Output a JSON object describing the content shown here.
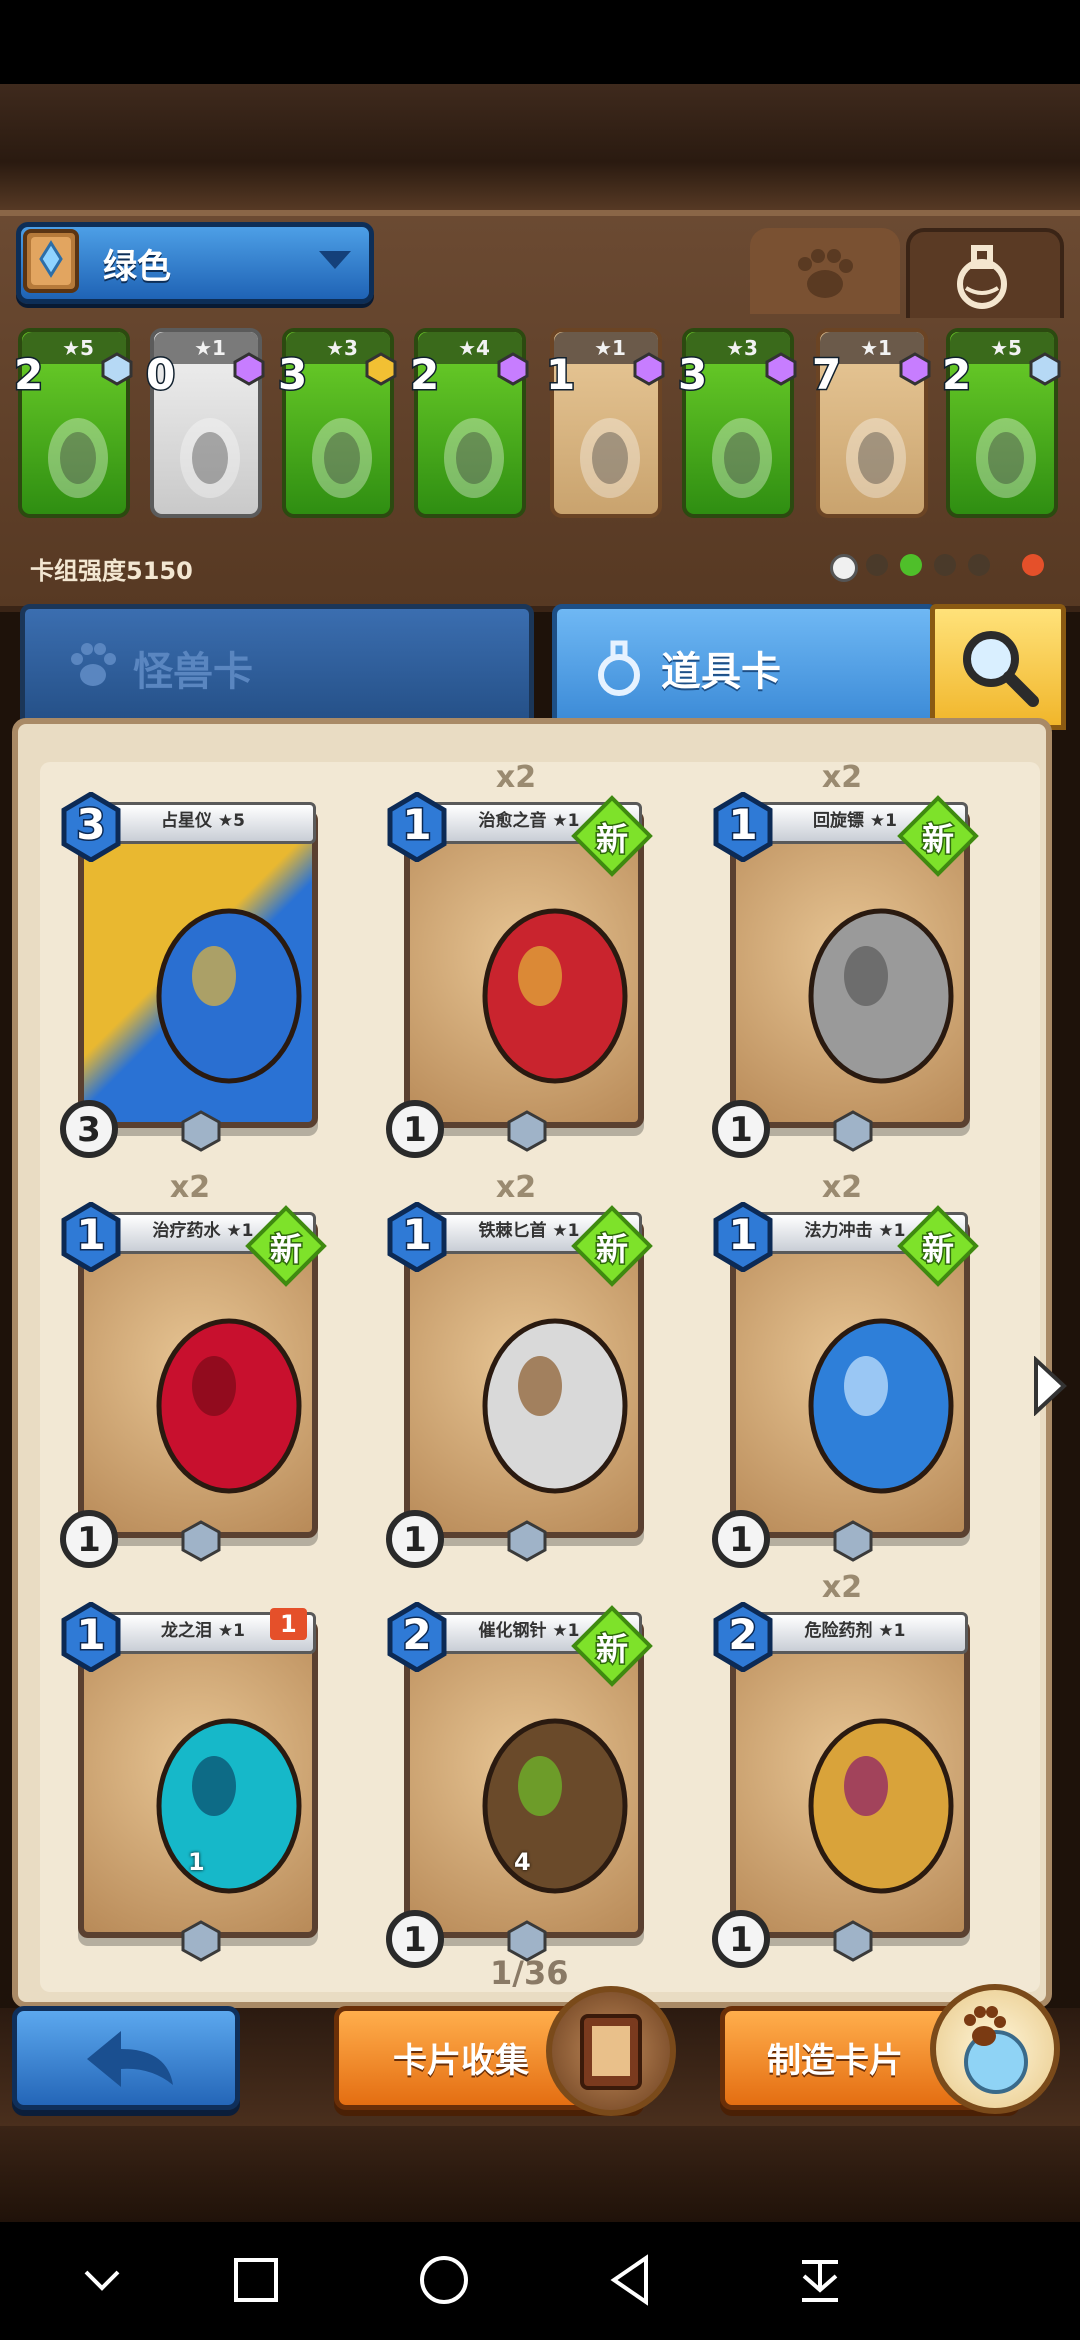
{
  "deck": {
    "name": "绿色",
    "strength": "卡组强度5150"
  },
  "deck_cards": [
    {
      "stars": "★5",
      "count": "2",
      "style": "green",
      "gem": "#b6d9f5"
    },
    {
      "stars": "★1",
      "count": "0",
      "style": "gray",
      "gem": "rainbow"
    },
    {
      "stars": "★3",
      "count": "3",
      "style": "green",
      "gem": "#f2c033"
    },
    {
      "stars": "★4",
      "count": "2",
      "style": "green",
      "gem": "rainbow"
    },
    {
      "stars": "★1",
      "count": "1",
      "style": "tan",
      "gem": "rainbow"
    },
    {
      "stars": "★3",
      "count": "3",
      "style": "green",
      "gem": "rainbow"
    },
    {
      "stars": "★1",
      "count": "7",
      "style": "tan",
      "gem": "rainbow"
    },
    {
      "stars": "★5",
      "count": "2",
      "style": "green",
      "gem": "#b6d9f5"
    }
  ],
  "tabs": {
    "monster": "怪兽卡",
    "item": "道具卡"
  },
  "cards": [
    {
      "name": "占星仪 ★5",
      "cost": "3",
      "dup": "",
      "new": false,
      "uses": "3",
      "art": "armillary"
    },
    {
      "name": "治愈之音 ★1",
      "cost": "1",
      "dup": "x2",
      "new": true,
      "uses": "1",
      "art": "harp"
    },
    {
      "name": "回旋镖 ★1",
      "cost": "1",
      "dup": "x2",
      "new": true,
      "uses": "1",
      "art": "boomerang"
    },
    {
      "name": "治疗药水 ★1",
      "cost": "1",
      "dup": "x2",
      "new": true,
      "uses": "1",
      "art": "potion"
    },
    {
      "name": "铁棘匕首 ★1",
      "cost": "1",
      "dup": "x2",
      "new": true,
      "uses": "1",
      "art": "dagger"
    },
    {
      "name": "法力冲击 ★1",
      "cost": "1",
      "dup": "x2",
      "new": true,
      "uses": "1",
      "art": "mana"
    },
    {
      "name": "龙之泪 ★1",
      "cost": "1",
      "dup": "",
      "new": false,
      "uses": "",
      "art": "egg",
      "flag": "1",
      "sub": "1"
    },
    {
      "name": "催化钢针 ★1",
      "cost": "2",
      "dup": "",
      "new": true,
      "uses": "1",
      "art": "needles",
      "sub": "4"
    },
    {
      "name": "危险药剂 ★1",
      "cost": "2",
      "dup": "x2",
      "new": false,
      "uses": "1",
      "art": "vial"
    }
  ],
  "new_label": "新",
  "page": "1/36",
  "buttons": {
    "collection": "卡片收集",
    "craft": "制造卡片"
  },
  "colors": {
    "blue_accent": "#3a89d6",
    "orange_accent": "#e46e12",
    "new_green": "#7ee22a"
  }
}
